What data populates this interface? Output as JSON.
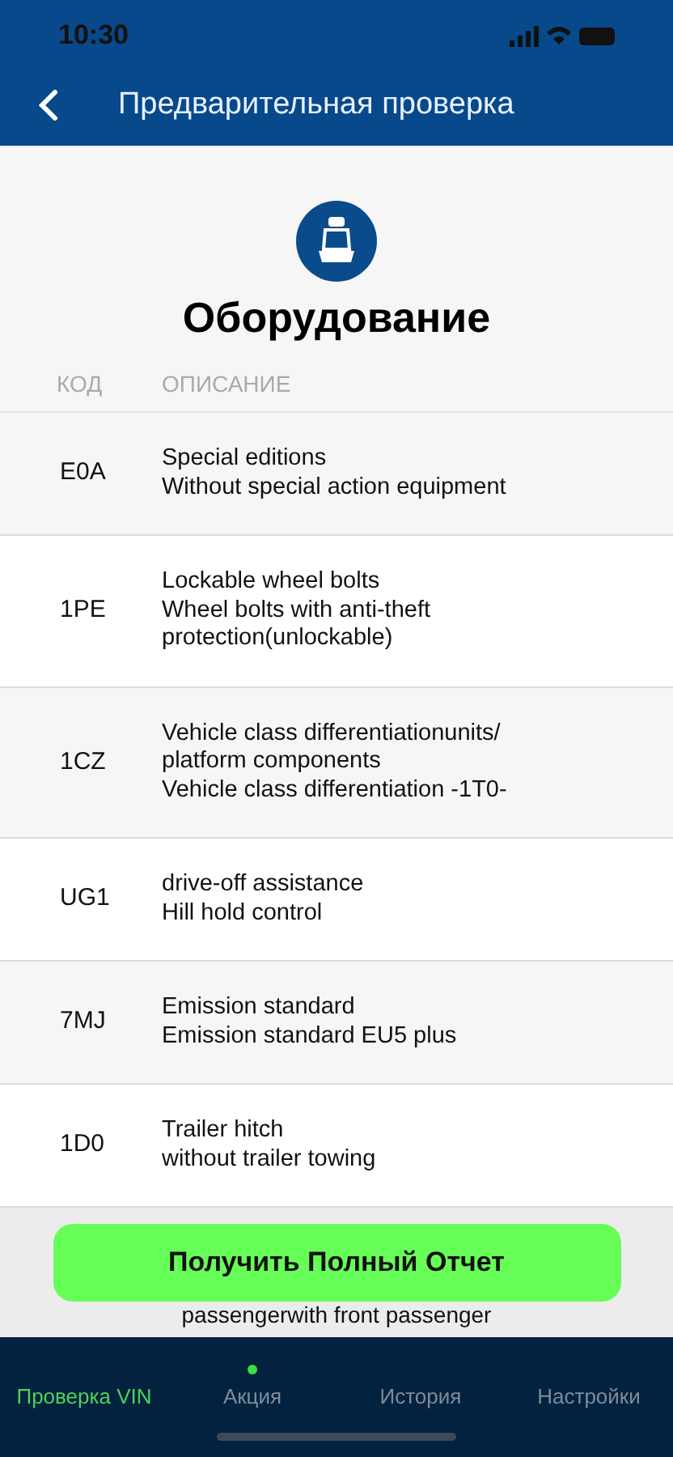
{
  "status_bar": {
    "time": "10:30"
  },
  "nav": {
    "title": "Предварительная проверка"
  },
  "section": {
    "title": "Оборудование"
  },
  "table": {
    "columns": [
      "КОД",
      "ОПИСАНИЕ"
    ],
    "rows": [
      {
        "code": "E0A",
        "lines": [
          "Special editions",
          "Without special action equipment"
        ]
      },
      {
        "code": "1PE",
        "lines": [
          "Lockable wheel bolts",
          "Wheel bolts with anti-theft protection(unlockable)"
        ]
      },
      {
        "code": "1CZ",
        "lines": [
          "Vehicle class differentiationunits/ platform components",
          "Vehicle class differentiation -1T0-"
        ]
      },
      {
        "code": "UG1",
        "lines": [
          "drive-off assistance",
          "Hill hold control"
        ]
      },
      {
        "code": "7MJ",
        "lines": [
          "Emission standard",
          "Emission standard EU5 plus"
        ]
      },
      {
        "code": "1D0",
        "lines": [
          "Trailer hitch",
          "without trailer towing"
        ]
      }
    ],
    "partial_line": "passengerwith front passenger"
  },
  "cta": {
    "label": "Получить Полный Отчет"
  },
  "tabs": [
    {
      "label": "Проверка VIN",
      "selected": true,
      "dot": false
    },
    {
      "label": "Акция",
      "selected": false,
      "dot": true
    },
    {
      "label": "История",
      "selected": false,
      "dot": false
    },
    {
      "label": "Настройки",
      "selected": false,
      "dot": false
    }
  ]
}
